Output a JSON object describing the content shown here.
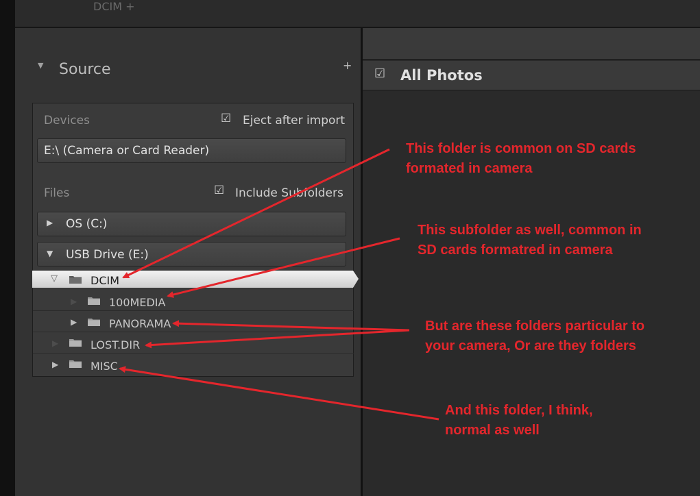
{
  "top": {
    "crumb": "DCIM +"
  },
  "source": {
    "title": "Source",
    "add_symbol": "+",
    "devices_label": "Devices",
    "eject_label": "Eject after import",
    "eject_checked": true,
    "device_name": "E:\\ (Camera or Card Reader)",
    "files_label": "Files",
    "subfolders_label": "Include Subfolders",
    "subfolders_checked": true,
    "drives": [
      {
        "label": "OS (C:)",
        "expanded": false
      },
      {
        "label": "USB Drive (E:)",
        "expanded": true
      }
    ],
    "tree": [
      {
        "label": "DCIM",
        "level": 0,
        "selected": true
      },
      {
        "label": "100MEDIA",
        "level": 1
      },
      {
        "label": "PANORAMA",
        "level": 1
      },
      {
        "label": "LOST.DIR",
        "level": 0
      },
      {
        "label": "MISC",
        "level": 0
      }
    ]
  },
  "right": {
    "all_photos": "All Photos",
    "all_photos_checked": true
  },
  "annotations": {
    "note1": [
      "This folder is common on SD cards",
      "formated in camera"
    ],
    "note2": [
      "This subfolder as well, common in",
      "SD cards formatred in camera"
    ],
    "note3": [
      "But are these folders particular to",
      "your camera, Or are they folders"
    ],
    "note4": [
      "And this folder, I think,",
      "normal as well"
    ]
  },
  "colors": {
    "annotation": "#e4262c",
    "panel": "#333333",
    "selected_row": "#e4e4e4"
  },
  "icons": {
    "check": "check-icon",
    "folder": "folder-icon",
    "expand": "triangle-right-icon",
    "collapse": "triangle-down-icon"
  }
}
